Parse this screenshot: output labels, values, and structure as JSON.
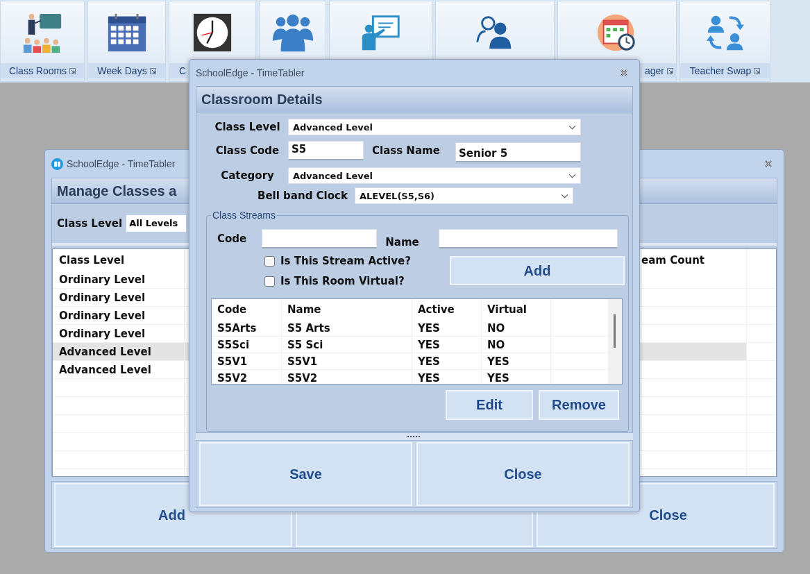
{
  "ribbon": {
    "buttons": [
      {
        "kind": "classroom",
        "label": "Class Rooms"
      },
      {
        "kind": "calendar",
        "label": "Week Days"
      },
      {
        "kind": "clock",
        "label": "C"
      },
      {
        "kind": "group"
      },
      {
        "kind": "presenter"
      },
      {
        "kind": "consult"
      },
      {
        "kind": "schedule",
        "label": "ager"
      },
      {
        "kind": "swap",
        "label": "Teacher Swap"
      }
    ]
  },
  "back_window": {
    "title": "SchoolEdge - TimeTabler",
    "heading": "Manage Classes a",
    "filter": {
      "label": "Class Level",
      "value": "All Levels"
    },
    "table": {
      "columns": [
        "Class Level",
        "eam Count"
      ],
      "rows": [
        {
          "class_level": "Ordinary Level",
          "selected": false
        },
        {
          "class_level": "Ordinary Level",
          "selected": false
        },
        {
          "class_level": "Ordinary Level",
          "selected": false
        },
        {
          "class_level": "Ordinary Level",
          "selected": false
        },
        {
          "class_level": "Advanced Level",
          "selected": true
        },
        {
          "class_level": "Advanced Level",
          "selected": false
        }
      ]
    },
    "buttons": [
      "Add",
      "Close"
    ]
  },
  "dialog": {
    "title": "SchoolEdge - TimeTabler",
    "heading": "Classroom Details",
    "class_level": {
      "label": "Class Level",
      "value": "Advanced Level"
    },
    "class_code": {
      "label": "Class Code",
      "value": "S5"
    },
    "class_name": {
      "label": "Class Name",
      "value": "Senior 5"
    },
    "category": {
      "label": "Category",
      "value": "Advanced Level"
    },
    "bell_band_clock": {
      "label": "Bell band Clock",
      "value": "ALEVEL(S5,S6)"
    },
    "streams": {
      "legend": "Class Streams",
      "code_label": "Code",
      "name_label": "Name",
      "checkboxes": [
        {
          "label": "Is This Stream Active?",
          "checked": false
        },
        {
          "label": "Is This Room Virtual?",
          "checked": false
        }
      ],
      "add_button": "Add",
      "table": {
        "columns": [
          "Code",
          "Name",
          "Active",
          "Virtual"
        ],
        "rows": [
          [
            "S5Arts",
            "S5 Arts",
            "YES",
            "NO"
          ],
          [
            "S5Sci",
            "S5 Sci",
            "YES",
            "NO"
          ],
          [
            "S5V1",
            "S5V1",
            "YES",
            "YES"
          ],
          [
            "S5V2",
            "S5V2",
            "YES",
            "YES"
          ]
        ]
      },
      "buttons": [
        "Edit",
        "Remove"
      ]
    },
    "buttons": [
      "Save",
      "Close"
    ]
  }
}
